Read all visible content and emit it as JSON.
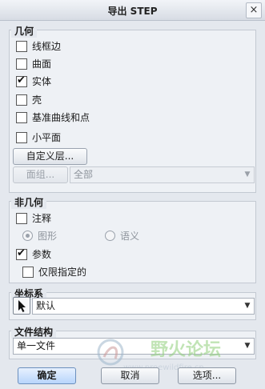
{
  "window": {
    "title": "导出 STEP",
    "close_symbol": "×"
  },
  "geometry_group": {
    "label": "几何",
    "options": [
      {
        "label": "线框边",
        "checked": false
      },
      {
        "label": "曲面",
        "checked": false
      },
      {
        "label": "实体",
        "checked": true
      },
      {
        "label": "壳",
        "checked": false
      },
      {
        "label": "基准曲线和点",
        "checked": false
      },
      {
        "label": "小平面",
        "checked": false
      }
    ],
    "custom_layer_button": "自定义层...",
    "face_group_button": "面组...",
    "face_group_select": "全部"
  },
  "non_geometry_group": {
    "label": "非几何",
    "annotation": {
      "label": "注释",
      "checked": false
    },
    "radios": [
      {
        "label": "图形",
        "checked": true
      },
      {
        "label": "语义",
        "checked": false
      }
    ],
    "parameters": {
      "label": "参数",
      "checked": true
    },
    "specified_only": {
      "label": "仅限指定的",
      "checked": false
    }
  },
  "coordinate_system": {
    "label": "坐标系",
    "value": "默认"
  },
  "file_structure": {
    "label": "文件结构",
    "value": "单一文件"
  },
  "buttons": {
    "ok": "确定",
    "cancel": "取消",
    "options": "选项..."
  },
  "watermark": {
    "text": "野火论坛",
    "url": "www.proewildfire.cn"
  }
}
